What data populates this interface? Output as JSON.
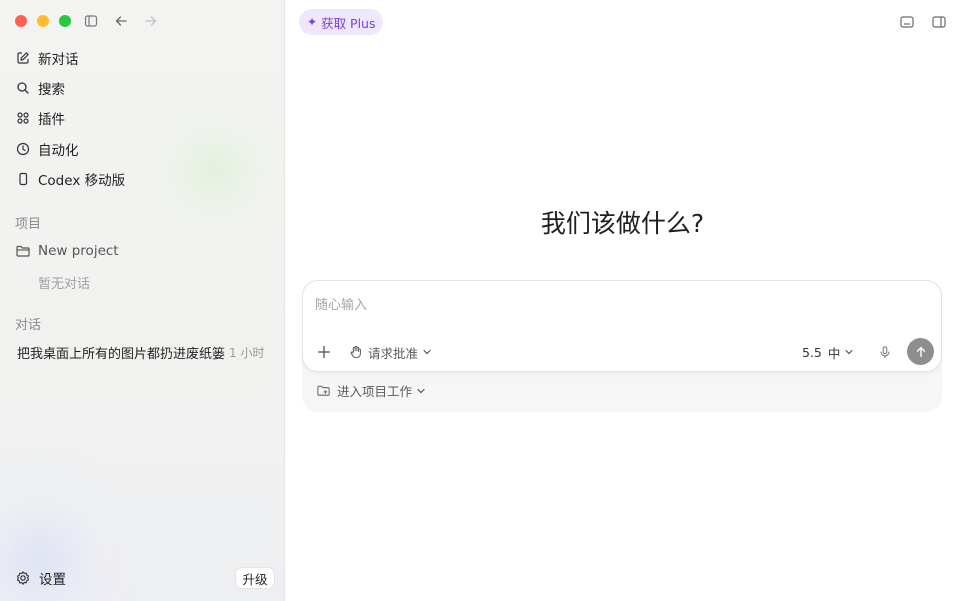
{
  "sidebar": {
    "nav": [
      {
        "label": "新对话",
        "icon": "edit-icon"
      },
      {
        "label": "搜索",
        "icon": "search-icon"
      },
      {
        "label": "插件",
        "icon": "plugins-grid-icon"
      },
      {
        "label": "自动化",
        "icon": "clock-icon"
      },
      {
        "label": "Codex 移动版",
        "icon": "mobile-phone-icon"
      }
    ],
    "projects_label": "项目",
    "project": {
      "label": "New project",
      "icon": "folder-icon"
    },
    "project_empty": "暂无对话",
    "conversations_label": "对话",
    "conversations": [
      {
        "title": "把我桌面上所有的图片都扔进废纸篓",
        "time": "1 小时"
      }
    ],
    "settings_label": "设置",
    "upgrade_label": "升级"
  },
  "main": {
    "plus_label": "获取 Plus",
    "heading": "我们该做什么?",
    "composer": {
      "placeholder": "随心输入",
      "approval_label": "请求批准",
      "model_version": "5.5",
      "effort_label": "中",
      "project_work_label": "进入项目工作"
    }
  },
  "colors": {
    "accent_purple": "#7b3fe4",
    "plus_bg": "#efe7fb",
    "send_button": "#8e8e8e"
  }
}
